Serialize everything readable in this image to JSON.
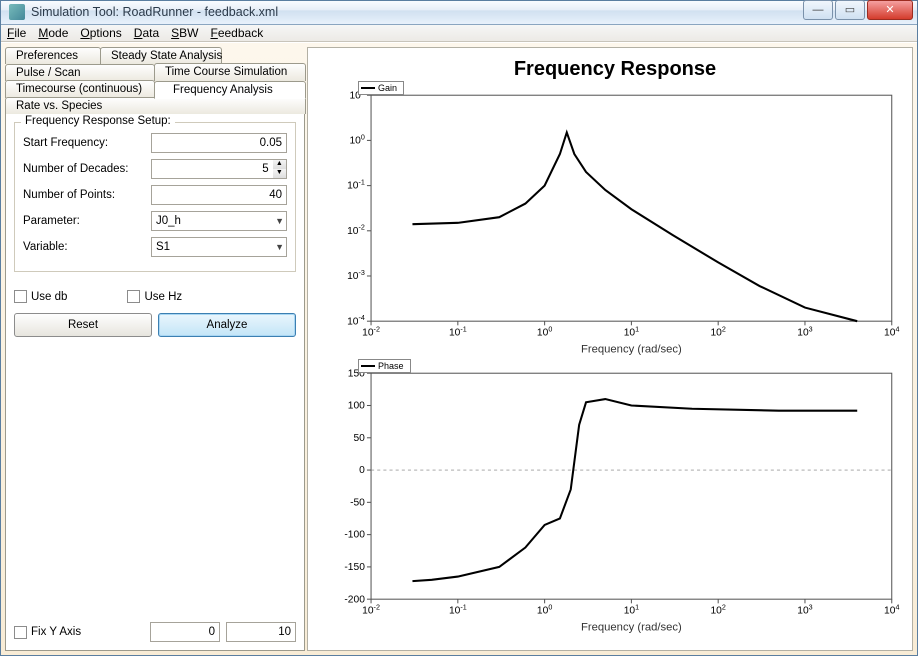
{
  "window": {
    "title": "Simulation Tool: RoadRunner - feedback.xml"
  },
  "menubar": [
    "File",
    "Mode",
    "Options",
    "Data",
    "SBW",
    "Feedback"
  ],
  "tabs": {
    "row1": [
      "Preferences",
      "Steady State Analysis",
      "Pulse / Scan"
    ],
    "row2": [
      "Time Course Simulation",
      "Timecourse (continuous)"
    ],
    "row3": [
      "Frequency Analysis",
      "Rate vs. Species"
    ],
    "active": "Frequency Analysis"
  },
  "form": {
    "legend": "Frequency Response Setup:",
    "startFreq": {
      "label": "Start Frequency:",
      "value": "0.05"
    },
    "decades": {
      "label": "Number of Decades:",
      "value": "5"
    },
    "points": {
      "label": "Number of Points:",
      "value": "40"
    },
    "parameter": {
      "label": "Parameter:",
      "value": "J0_h"
    },
    "variable": {
      "label": "Variable:",
      "value": "S1"
    }
  },
  "checks": {
    "useDb": "Use db",
    "useHz": "Use Hz"
  },
  "buttons": {
    "reset": "Reset",
    "analyze": "Analyze"
  },
  "fix": {
    "label": "Fix Y Axis",
    "low": "0",
    "high": "10"
  },
  "chartTitle": "Frequency Response",
  "legendGain": "Gain",
  "legendPhase": "Phase",
  "xlabel": "Frequency (rad/sec)",
  "chart_data": [
    {
      "type": "line",
      "name": "Gain",
      "xscale": "log",
      "yscale": "log",
      "xlim": [
        0.01,
        10000
      ],
      "ylim": [
        0.0001,
        10
      ],
      "xticks": [
        0.01,
        0.1,
        1,
        10,
        100,
        1000,
        10000
      ],
      "yticks": [
        0.0001,
        0.001,
        0.01,
        0.1,
        1,
        10
      ],
      "xlabel": "Frequency (rad/sec)",
      "x": [
        0.03,
        0.1,
        0.3,
        0.6,
        1,
        1.5,
        1.8,
        2.2,
        3,
        5,
        10,
        30,
        100,
        300,
        1000,
        4000
      ],
      "y": [
        0.014,
        0.015,
        0.02,
        0.04,
        0.1,
        0.5,
        1.5,
        0.5,
        0.2,
        0.08,
        0.03,
        0.008,
        0.002,
        0.0006,
        0.0002,
        0.0001
      ]
    },
    {
      "type": "line",
      "name": "Phase",
      "xscale": "log",
      "yscale": "linear",
      "xlim": [
        0.01,
        10000
      ],
      "ylim": [
        -200,
        150
      ],
      "xticks": [
        0.01,
        0.1,
        1,
        10,
        100,
        1000,
        10000
      ],
      "yticks": [
        -200,
        -150,
        -100,
        -50,
        0,
        50,
        100,
        150
      ],
      "xlabel": "Frequency (rad/sec)",
      "x": [
        0.03,
        0.05,
        0.1,
        0.3,
        0.6,
        1,
        1.5,
        2,
        2.5,
        3,
        5,
        10,
        50,
        500,
        4000
      ],
      "y": [
        -172,
        -170,
        -165,
        -150,
        -120,
        -85,
        -75,
        -30,
        70,
        105,
        110,
        100,
        95,
        92,
        92
      ]
    }
  ]
}
